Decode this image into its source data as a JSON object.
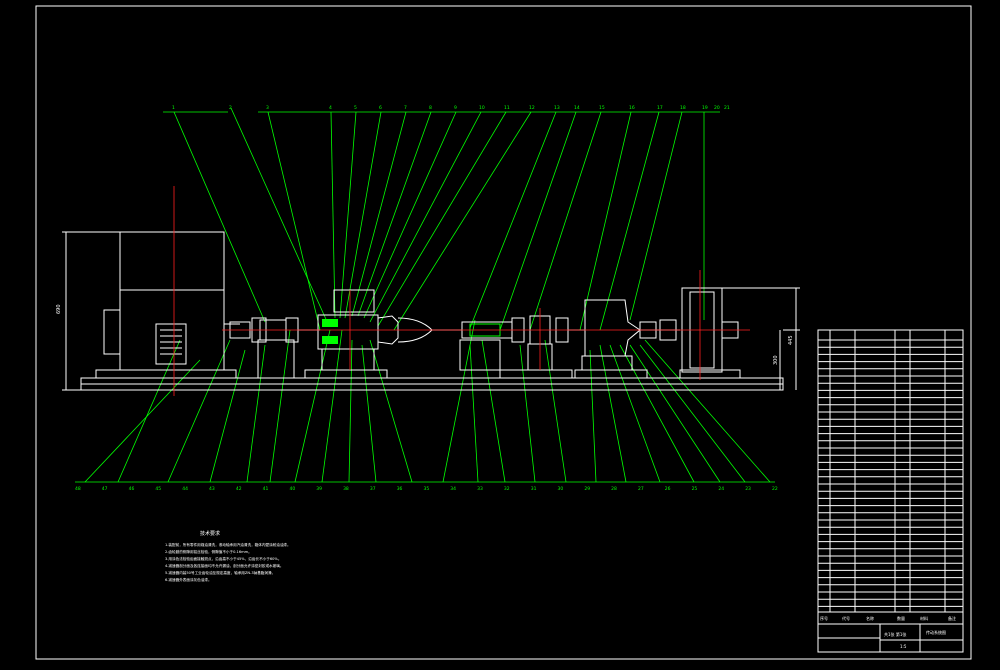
{
  "drawing": {
    "notes_title": "技术要求",
    "notes_lines": [
      "1.装配前，所有零件用煤油清洗，滚动轴承用汽油清洗，箱体内壁涂耐油油漆。",
      "2.齿轮副的侧隙用铅丝检验，侧隙值不小于0.16mm。",
      "3.用涂色法检验齿面接触斑点，沿齿高不小于45%，沿齿长不小于60%。",
      "4.减速器剖分面及各连接面均不允许漏油，剖分面允许涂密封胶或水玻璃。",
      "5.减速器内装50号工业齿轮油至规定高度，轴承用ZN-3钠基脂润滑。",
      "6.减速器外表面涂灰色油漆。"
    ],
    "top_callouts": [
      "1",
      "2",
      "3",
      "4",
      "5",
      "6",
      "7",
      "8",
      "9",
      "10",
      "11",
      "12",
      "13",
      "14",
      "15",
      "16",
      "17",
      "18",
      "19",
      "20",
      "21"
    ],
    "bottom_callouts": [
      "48",
      "47",
      "46",
      "45",
      "44",
      "43",
      "42",
      "41",
      "40",
      "39",
      "38",
      "37",
      "36",
      "35",
      "34",
      "33",
      "32",
      "31",
      "30",
      "29",
      "28",
      "27",
      "26",
      "25",
      "24",
      "23",
      "22"
    ],
    "dimension_left": "690",
    "dimension_right_1": "445",
    "dimension_right_2": "300"
  },
  "title_block": {
    "header_cols": [
      "序号",
      "代号",
      "名称",
      "数量",
      "材料",
      "备注"
    ],
    "drawing_name": "传动系统图",
    "scale": "1:5",
    "sheet": "共1张 第1张"
  },
  "colors": {
    "background": "#000000",
    "outline": "#ffffff",
    "leader": "#00ff00",
    "centerline": "#ff2020",
    "highlight": "#ffff00"
  }
}
